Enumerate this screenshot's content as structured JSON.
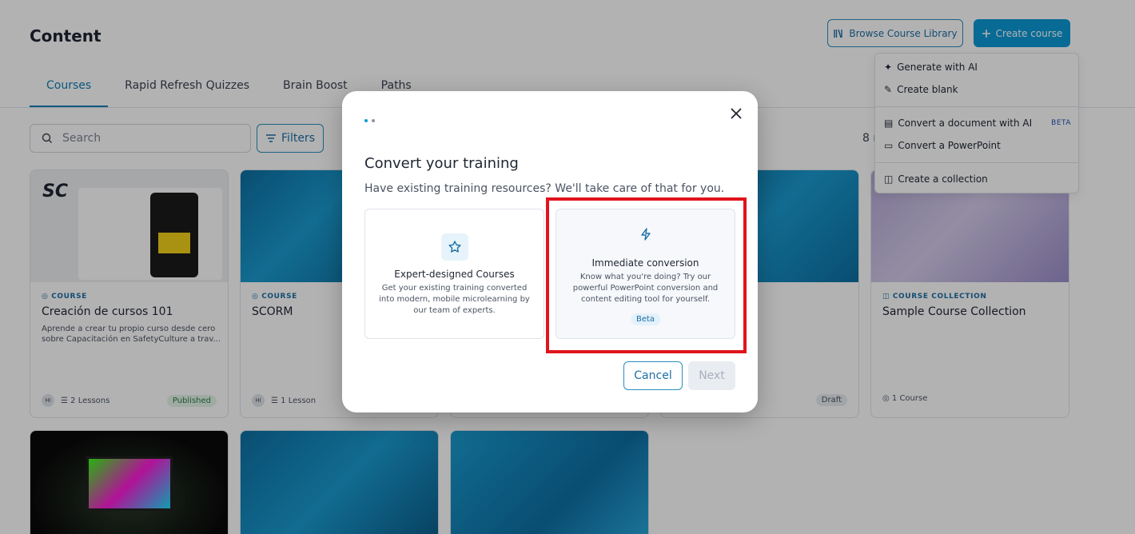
{
  "header": {
    "title": "Content",
    "browse_label": "Browse Course Library",
    "create_label": "Create course"
  },
  "tabs": [
    {
      "label": "Courses",
      "active": true
    },
    {
      "label": "Rapid Refresh Quizzes",
      "active": false
    },
    {
      "label": "Brain Boost",
      "active": false
    },
    {
      "label": "Paths",
      "active": false
    }
  ],
  "search": {
    "placeholder": "Search"
  },
  "filters_label": "Filters",
  "count_text": "8 r",
  "create_menu": {
    "items": [
      {
        "label": "Generate with AI",
        "icon": "sparkle-icon"
      },
      {
        "label": "Create blank",
        "icon": "pencil-icon"
      },
      {
        "label": "Convert a document with AI",
        "icon": "document-icon",
        "badge": "BETA"
      },
      {
        "label": "Convert a PowerPoint",
        "icon": "presentation-icon"
      },
      {
        "label": "Create a collection",
        "icon": "collection-icon"
      }
    ]
  },
  "cards": [
    {
      "type": "COURSE",
      "title": "Creación de cursos 101",
      "desc": "Aprende a crear tu propio curso desde cero sobre Capacitación en SafetyCulture a trav...",
      "avatar": "HI",
      "lessons": "2 Lessons",
      "status": "Published"
    },
    {
      "type": "COURSE",
      "title": "SCORM",
      "desc": "",
      "avatar": "HI",
      "lessons": "1 Lesson",
      "status": ""
    },
    {
      "type": "",
      "title": "",
      "desc": "",
      "avatar": "",
      "lessons": "",
      "status": ""
    },
    {
      "type": "",
      "title": "",
      "desc": "",
      "avatar": "",
      "lessons": "",
      "status": "Draft"
    },
    {
      "type": "COURSE COLLECTION",
      "title": "Sample Course Collection",
      "desc": "",
      "avatar": "",
      "lessons": "1 Course",
      "status": ""
    }
  ],
  "modal": {
    "title": "Convert your training",
    "subtitle": "Have existing training resources? We'll take care of that for you.",
    "options": [
      {
        "title": "Expert-designed Courses",
        "desc": "Get your existing training converted into modern, mobile microlearning by our team of experts.",
        "icon": "star-icon",
        "badge": ""
      },
      {
        "title": "Immediate conversion",
        "desc": "Know what you're doing? Try our powerful PowerPoint conversion and content editing tool for yourself.",
        "icon": "lightning-icon",
        "badge": "Beta"
      }
    ],
    "cancel_label": "Cancel",
    "next_label": "Next"
  },
  "colors": {
    "accent": "#0c9ad6",
    "highlight": "#e0141c"
  }
}
